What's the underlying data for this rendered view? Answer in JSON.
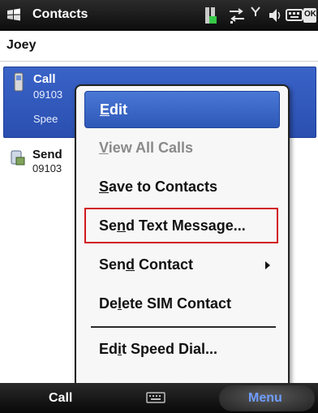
{
  "titlebar": {
    "title": "Contacts",
    "icons": [
      "windows-start-icon",
      "battery-icon",
      "data-sync-icon",
      "signal-icon",
      "volume-icon",
      "keyboard-icon",
      "ok-icon"
    ],
    "ok_label": "OK"
  },
  "contact": {
    "name": "Joey"
  },
  "list": {
    "rows": [
      {
        "title": "Call",
        "number": "09103",
        "sub": "Spee",
        "icon": "mobile-phone-icon",
        "selected": true
      },
      {
        "title": "Send",
        "number": "09103",
        "icon": "message-icon",
        "selected": false
      }
    ]
  },
  "popup_menu": {
    "items": [
      {
        "label_pre": "",
        "label_ul": "E",
        "label_post": "dit",
        "state": "highlighted"
      },
      {
        "label_pre": "",
        "label_ul": "V",
        "label_post": "iew All Calls",
        "state": "disabled"
      },
      {
        "label_pre": "",
        "label_ul": "S",
        "label_post": "ave to Contacts",
        "state": "normal"
      },
      {
        "label_pre": "Se",
        "label_ul": "n",
        "label_post": "d Text Message...",
        "state": "outlined"
      },
      {
        "label_pre": "Sen",
        "label_ul": "d",
        "label_post": " Contact",
        "state": "submenu"
      },
      {
        "label_pre": "De",
        "label_ul": "l",
        "label_post": "ete SIM Contact",
        "state": "normal"
      },
      {
        "label_pre": "Ed",
        "label_ul": "i",
        "label_post": "t Speed Dial...",
        "state": "normal"
      }
    ]
  },
  "softkeys": {
    "left": "Call",
    "right": "Menu",
    "middle_icon": "keyboard-icon"
  },
  "colors": {
    "highlight": "#3561c4",
    "outline": "#d0191f",
    "menu_softkey_text": "#6f9dff"
  }
}
